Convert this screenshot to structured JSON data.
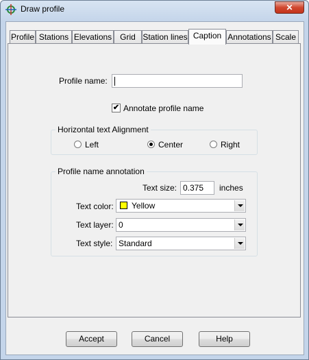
{
  "window": {
    "title": "Draw profile",
    "close_glyph": "✕"
  },
  "tabs": [
    {
      "label": "Profile"
    },
    {
      "label": "Stations"
    },
    {
      "label": "Elevations"
    },
    {
      "label": "Grid"
    },
    {
      "label": "Station lines"
    },
    {
      "label": "Caption",
      "active": true
    },
    {
      "label": "Annotations"
    },
    {
      "label": "Scale"
    }
  ],
  "caption": {
    "profile_name_label": "Profile name:",
    "profile_name_value": "",
    "annotate_label": "Annotate profile name",
    "annotate_checked": true,
    "check_glyph": "✔",
    "alignment": {
      "legend": "Horizontal text Alignment",
      "options": [
        "Left",
        "Center",
        "Right"
      ],
      "selected": "Center"
    },
    "annotation": {
      "legend": "Profile name annotation",
      "text_size_label": "Text size:",
      "text_size_value": "0.375",
      "text_size_unit": "inches",
      "text_color_label": "Text color:",
      "text_color_value": "Yellow",
      "text_color_swatch": "#ffff00",
      "text_layer_label": "Text layer:",
      "text_layer_value": "0",
      "text_style_label": "Text style:",
      "text_style_value": "Standard"
    }
  },
  "buttons": {
    "accept": "Accept",
    "cancel": "Cancel",
    "help": "Help"
  },
  "icons": {
    "app": "profile-target-icon",
    "dropdown": "chevron-down-icon"
  }
}
